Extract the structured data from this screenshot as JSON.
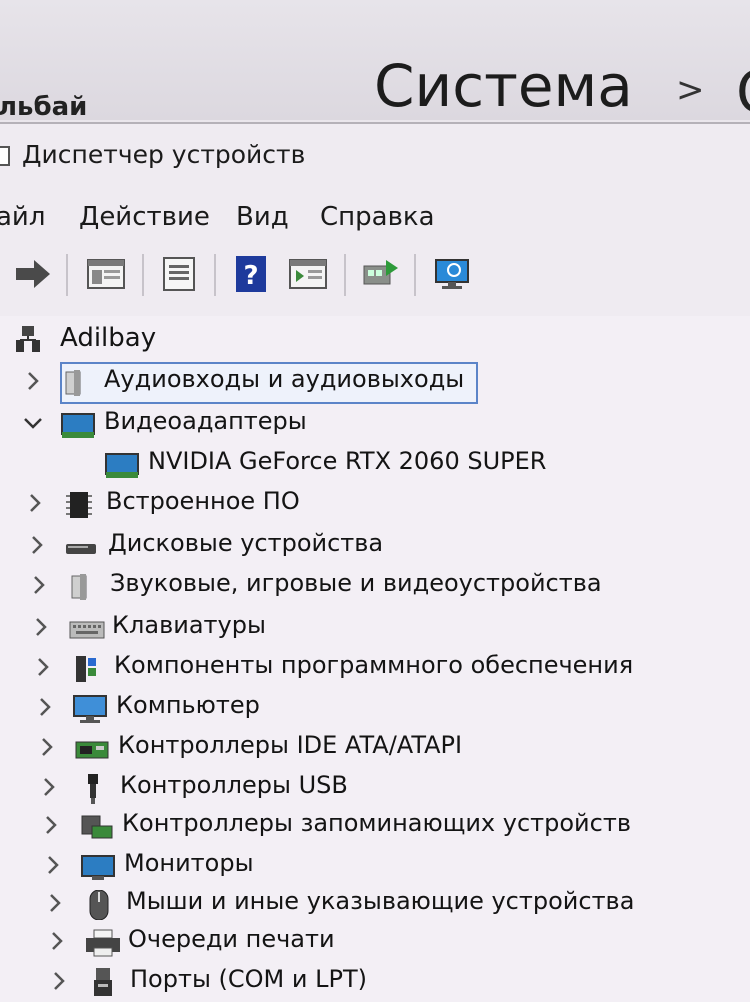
{
  "background": {
    "title": "Система",
    "chevron": ">",
    "clipped_char": "С",
    "user_fragment": "льбай"
  },
  "window": {
    "title": "Диспетчер устройств"
  },
  "menu": [
    "айл",
    "Действие",
    "Вид",
    "Справка"
  ],
  "toolbar": [
    "forward-icon",
    "show-hide-console-tree-icon",
    "properties-icon",
    "help-icon",
    "action-pane-icon",
    "update-driver-icon",
    "scan-hardware-icon"
  ],
  "tree": {
    "root": "Adilbay",
    "items": [
      {
        "label": "Аудиовходы и аудиовыходы",
        "expanded": false,
        "selected": true,
        "icon": "speaker-icon"
      },
      {
        "label": "Видеоадаптеры",
        "expanded": true,
        "icon": "display-adapter-icon"
      },
      {
        "label": "NVIDIA GeForce RTX 2060 SUPER",
        "child": true,
        "icon": "display-adapter-icon"
      },
      {
        "label": "Встроенное ПО",
        "expanded": false,
        "icon": "firmware-chip-icon"
      },
      {
        "label": "Дисковые устройства",
        "expanded": false,
        "icon": "disk-drive-icon"
      },
      {
        "label": "Звуковые, игровые и видеоустройства",
        "expanded": false,
        "icon": "speaker-icon"
      },
      {
        "label": "Клавиатуры",
        "expanded": false,
        "icon": "keyboard-icon"
      },
      {
        "label": "Компоненты программного обеспечения",
        "expanded": false,
        "icon": "software-component-icon"
      },
      {
        "label": "Компьютер",
        "expanded": false,
        "icon": "computer-monitor-icon"
      },
      {
        "label": "Контроллеры IDE ATA/ATAPI",
        "expanded": false,
        "icon": "ide-controller-icon"
      },
      {
        "label": "Контроллеры USB",
        "expanded": false,
        "icon": "usb-icon"
      },
      {
        "label": "Контроллеры запоминающих устройств",
        "expanded": false,
        "icon": "storage-controller-icon"
      },
      {
        "label": "Мониторы",
        "expanded": false,
        "icon": "monitor-icon"
      },
      {
        "label": "Мыши и иные указывающие устройства",
        "expanded": false,
        "icon": "mouse-icon"
      },
      {
        "label": "Очереди печати",
        "expanded": false,
        "icon": "printer-icon"
      },
      {
        "label": "Порты (COM и LPT)",
        "expanded": false,
        "icon": "port-icon"
      }
    ]
  }
}
